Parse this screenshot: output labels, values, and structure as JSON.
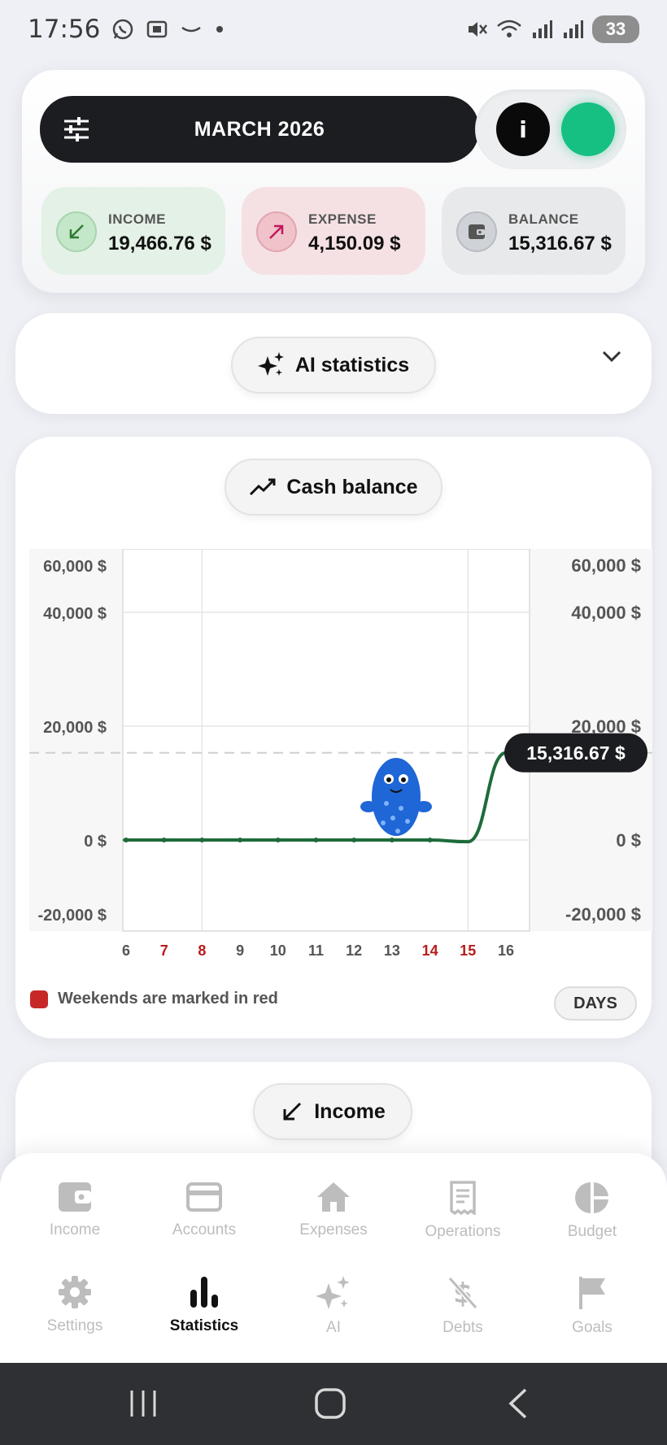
{
  "status_bar": {
    "time": "17:56",
    "battery": "33"
  },
  "header": {
    "month_label": "MARCH 2026",
    "info_label": "i"
  },
  "summary": {
    "income": {
      "label": "INCOME",
      "value": "19,466.76 $"
    },
    "expense": {
      "label": "EXPENSE",
      "value": "4,150.09 $"
    },
    "balance": {
      "label": "BALANCE",
      "value": "15,316.67 $"
    }
  },
  "ai_card": {
    "label": "AI statistics"
  },
  "cash_card": {
    "label": "Cash balance",
    "legend": "Weekends are marked in red",
    "period_button": "DAYS"
  },
  "chart_data": {
    "type": "line",
    "x": [
      6,
      7,
      8,
      9,
      10,
      11,
      12,
      13,
      14,
      15,
      16
    ],
    "x_labels": [
      "6",
      "7",
      "8",
      "9",
      "10",
      "11",
      "12",
      "13",
      "14",
      "15",
      "16"
    ],
    "weekend_days": [
      7,
      8,
      14,
      15
    ],
    "series": [
      {
        "values": [
          0,
          0,
          0,
          0,
          0,
          0,
          0,
          0,
          0,
          -1500,
          15316.67
        ]
      }
    ],
    "y_ticks": [
      "60,000 $",
      "40,000 $",
      "20,000 $",
      "0 $",
      "-20,000 $"
    ],
    "y_tick_values": [
      60000,
      40000,
      20000,
      0,
      -20000
    ],
    "ylim": [
      -20000,
      60000
    ],
    "current_value_label": "15,316.67 $",
    "reference_line": 15316.67,
    "line_color": "#1e6b3a",
    "weekend_color": "#b71c1c",
    "grid": true
  },
  "income_card": {
    "label": "Income"
  },
  "nav": {
    "row1": [
      {
        "label": "Income",
        "icon": "wallet-icon"
      },
      {
        "label": "Accounts",
        "icon": "card-icon"
      },
      {
        "label": "Expenses",
        "icon": "home-icon"
      },
      {
        "label": "Operations",
        "icon": "receipt-icon"
      },
      {
        "label": "Budget",
        "icon": "pie-icon"
      }
    ],
    "row2": [
      {
        "label": "Settings",
        "icon": "gear-icon"
      },
      {
        "label": "Statistics",
        "icon": "bar-chart-icon"
      },
      {
        "label": "AI",
        "icon": "sparkle-icon"
      },
      {
        "label": "Debts",
        "icon": "no-dollar-icon"
      },
      {
        "label": "Goals",
        "icon": "flag-icon"
      }
    ]
  },
  "colors": {
    "accent_green": "#16c083",
    "income_green": "#2e7d32",
    "expense_red": "#c2185b"
  }
}
